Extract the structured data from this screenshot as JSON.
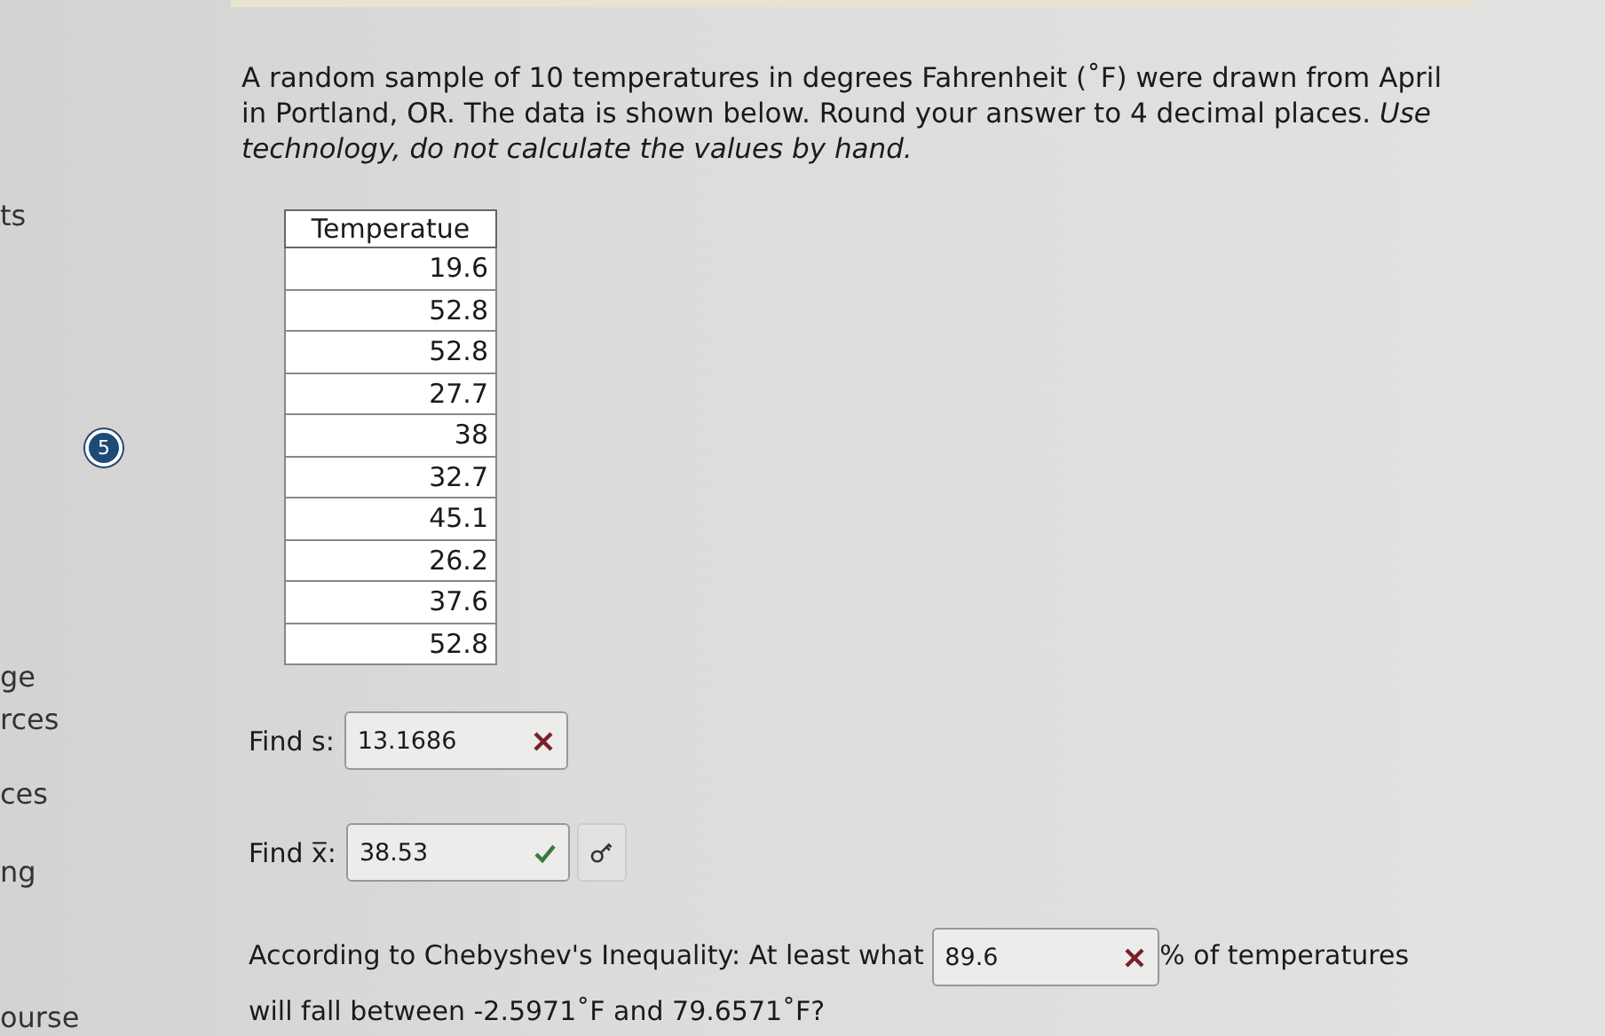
{
  "sidebar": {
    "items": [
      {
        "label": "ts"
      },
      {
        "label": "ge"
      },
      {
        "label": "rces"
      },
      {
        "label": "ces"
      },
      {
        "label": "ng"
      },
      {
        "label": "ourse"
      }
    ],
    "badge": "5"
  },
  "question": {
    "intro": "A random sample of 10 temperatures in degrees Fahrenheit (˚F) were drawn from April in Portland, OR. The data is shown below. Round your answer to 4 decimal places. *Use technology, do not calculate the values by hand.*",
    "table": {
      "columns": [
        "Temperatue"
      ],
      "rows": [
        [
          "19.6"
        ],
        [
          "52.8"
        ],
        [
          "52.8"
        ],
        [
          "27.7"
        ],
        [
          "38"
        ],
        [
          "32.7"
        ],
        [
          "45.1"
        ],
        [
          "26.2"
        ],
        [
          "37.6"
        ],
        [
          "52.8"
        ]
      ]
    },
    "answers": [
      {
        "kind": "field",
        "label": "Find s:",
        "value": "13.1686",
        "correct": false,
        "key": false
      },
      {
        "kind": "field",
        "label": "Find x̅:",
        "value": "38.53",
        "correct": true,
        "key": true
      },
      {
        "kind": "inline",
        "before": "According to Chebyshev's Inequality: At least what",
        "value": "89.6",
        "correct": false,
        "after": "% of temperatures will fall between -2.5971˚F and 79.6571˚F?"
      }
    ]
  }
}
